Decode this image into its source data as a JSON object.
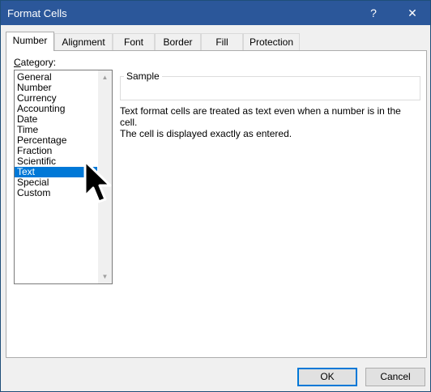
{
  "window": {
    "title": "Format Cells",
    "help_glyph": "?",
    "close_glyph": "✕"
  },
  "tabs": [
    {
      "label": "Number",
      "active": true
    },
    {
      "label": "Alignment",
      "active": false
    },
    {
      "label": "Font",
      "active": false
    },
    {
      "label": "Border",
      "active": false
    },
    {
      "label": "Fill",
      "active": false
    },
    {
      "label": "Protection",
      "active": false
    }
  ],
  "category": {
    "label_prefix": "C",
    "label_rest": "ategory:",
    "items": [
      "General",
      "Number",
      "Currency",
      "Accounting",
      "Date",
      "Time",
      "Percentage",
      "Fraction",
      "Scientific",
      "Text",
      "Special",
      "Custom"
    ],
    "selected": "Text"
  },
  "sample": {
    "label": "Sample"
  },
  "description": {
    "line1": "Text format cells are treated as text even when a number is in the cell.",
    "line2": "The cell is displayed exactly as entered."
  },
  "buttons": {
    "ok_label": "OK",
    "cancel_label": "Cancel"
  },
  "colors": {
    "titlebar": "#2b579a",
    "selection": "#0078d7"
  }
}
